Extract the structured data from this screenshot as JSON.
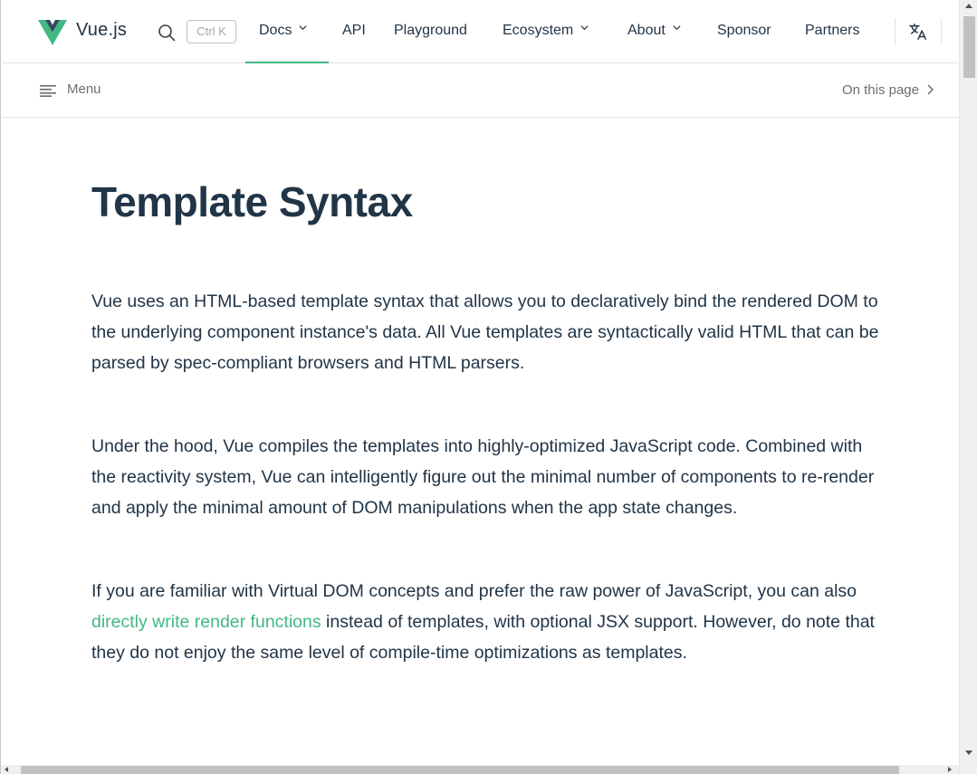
{
  "nav": {
    "brand": "Vue.js",
    "search_shortcut": "Ctrl K",
    "items": [
      {
        "label": "Docs",
        "has_dropdown": true,
        "active": true
      },
      {
        "label": "API",
        "has_dropdown": false
      },
      {
        "label": "Playground",
        "has_dropdown": false
      },
      {
        "label": "Ecosystem",
        "has_dropdown": true
      },
      {
        "label": "About",
        "has_dropdown": true
      },
      {
        "label": "Sponsor",
        "has_dropdown": false
      },
      {
        "label": "Partners",
        "has_dropdown": false
      }
    ],
    "icons": [
      "vue-logo-icon",
      "search-icon",
      "chevron-down-icon",
      "translate-icon"
    ]
  },
  "localnav": {
    "menu_label": "Menu",
    "on_this_page_label": "On this page"
  },
  "page": {
    "title": "Template Syntax",
    "paragraphs": [
      {
        "text": "Vue uses an HTML-based template syntax that allows you to declaratively bind the rendered DOM to the underlying component instance's data. All Vue templates are syntactically valid HTML that can be parsed by spec-compliant browsers and HTML parsers."
      },
      {
        "text": "Under the hood, Vue compiles the templates into highly-optimized JavaScript code. Combined with the reactivity system, Vue can intelligently figure out the minimal number of components to re-render and apply the minimal amount of DOM manipulations when the app state changes."
      },
      {
        "before": "If you are familiar with Virtual DOM concepts and prefer the raw power of JavaScript, you can also ",
        "link": "directly write render functions",
        "after": " instead of templates, with optional JSX support. However, do note that they do not enjoy the same level of compile-time optimizations as templates."
      }
    ]
  },
  "colors": {
    "accent": "#42b883",
    "text": "#213547",
    "divider": "#e2e2e3"
  }
}
